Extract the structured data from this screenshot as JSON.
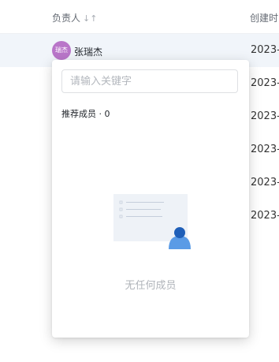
{
  "table": {
    "header": {
      "owner": "负责人",
      "owner_sort_icon": "sort-icon",
      "created": "创建时"
    },
    "rows": [
      {
        "owner_avatar": "瑞杰",
        "owner_name": "张瑞杰",
        "created": "2023-"
      },
      {
        "created": "2023-"
      },
      {
        "created": "2023-"
      },
      {
        "created": "2023-"
      },
      {
        "created": "2023-"
      },
      {
        "created": "2023-"
      }
    ]
  },
  "popover": {
    "search_placeholder": "请输入关键字",
    "section_title": "推荐成员 · 0",
    "empty_text": "无任何成员",
    "illustration": "empty-members-illustration"
  },
  "colors": {
    "highlight_row": "#f1f5fa",
    "avatar": "#b976c9",
    "illustration_accent": "#1f5fb8",
    "illustration_body": "#5a9be6"
  }
}
